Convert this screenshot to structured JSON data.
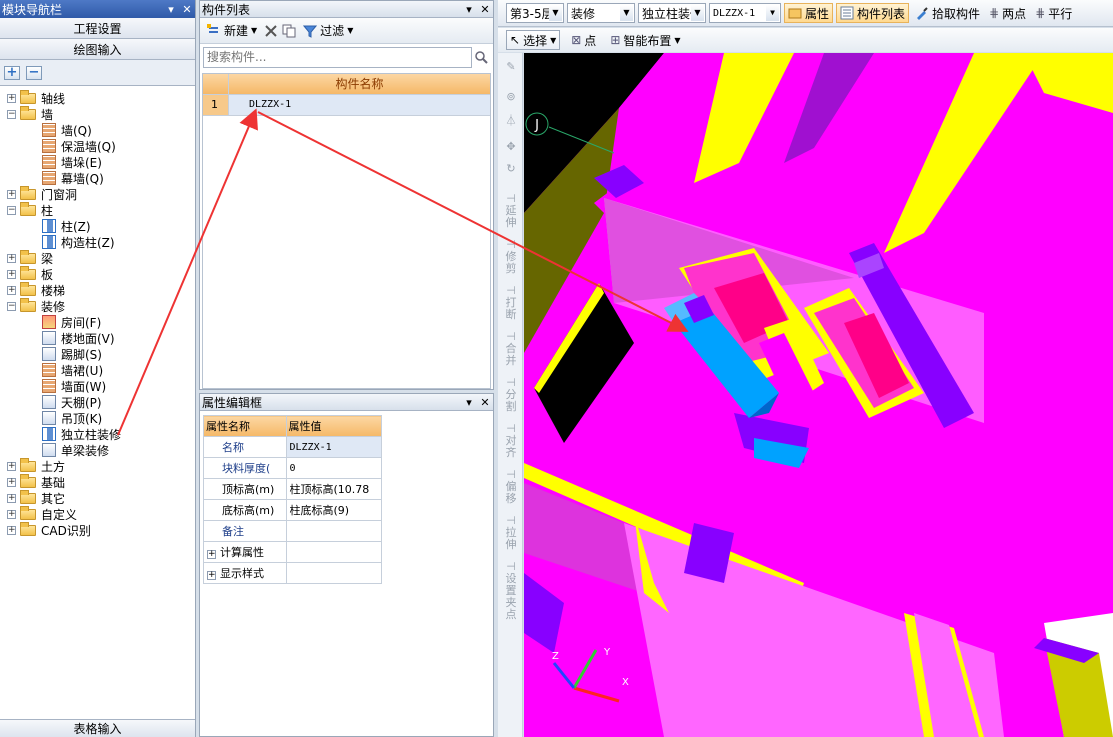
{
  "nav": {
    "title": "模块导航栏",
    "pin": "ᵖ",
    "close": "✕",
    "section1": "工程设置",
    "section2": "绘图输入",
    "bottom": "表格输入",
    "items": [
      {
        "label": "轴线",
        "level": 0,
        "exp": "+"
      },
      {
        "label": "墙",
        "level": 0,
        "exp": "−"
      },
      {
        "label": "墙(Q)",
        "level": 1
      },
      {
        "label": "保温墙(Q)",
        "level": 1
      },
      {
        "label": "墙垛(E)",
        "level": 1
      },
      {
        "label": "幕墙(Q)",
        "level": 1
      },
      {
        "label": "门窗洞",
        "level": 0,
        "exp": "+"
      },
      {
        "label": "柱",
        "level": 0,
        "exp": "−"
      },
      {
        "label": "柱(Z)",
        "level": 1
      },
      {
        "label": "构造柱(Z)",
        "level": 1
      },
      {
        "label": "梁",
        "level": 0,
        "exp": "+"
      },
      {
        "label": "板",
        "level": 0,
        "exp": "+"
      },
      {
        "label": "楼梯",
        "level": 0,
        "exp": "+"
      },
      {
        "label": "装修",
        "level": 0,
        "exp": "−"
      },
      {
        "label": "房间(F)",
        "level": 1
      },
      {
        "label": "楼地面(V)",
        "level": 1
      },
      {
        "label": "踢脚(S)",
        "level": 1
      },
      {
        "label": "墙裙(U)",
        "level": 1
      },
      {
        "label": "墙面(W)",
        "level": 1
      },
      {
        "label": "天棚(P)",
        "level": 1
      },
      {
        "label": "吊顶(K)",
        "level": 1
      },
      {
        "label": "独立柱装修",
        "level": 1
      },
      {
        "label": "单梁装修",
        "level": 1
      },
      {
        "label": "土方",
        "level": 0,
        "exp": "+"
      },
      {
        "label": "基础",
        "level": 0,
        "exp": "+"
      },
      {
        "label": "其它",
        "level": 0,
        "exp": "+"
      },
      {
        "label": "自定义",
        "level": 0,
        "exp": "+"
      },
      {
        "label": "CAD识别",
        "level": 0,
        "exp": "+"
      }
    ]
  },
  "clist": {
    "title": "构件列表",
    "new_label": "新建",
    "filter_label": "过滤",
    "search_placeholder": "搜索构件...",
    "col_header": "构件名称",
    "rows": [
      {
        "n": "1",
        "name": "DLZZX-1"
      }
    ]
  },
  "props": {
    "title": "属性编辑框",
    "col_name": "属性名称",
    "col_value": "属性值",
    "rows": [
      {
        "k": "名称",
        "v": "DLZZX-1"
      },
      {
        "k": "块料厚度(",
        "v": "0"
      },
      {
        "k": "顶标高(m)",
        "v": "柱顶标高(10.78"
      },
      {
        "k": "底标高(m)",
        "v": "柱底标高(9)"
      },
      {
        "k": "备注",
        "v": ""
      }
    ],
    "groups": [
      "计算属性",
      "显示样式"
    ]
  },
  "toolbar": {
    "floor": "第3-5层",
    "category": "装修",
    "type": "独立柱装修",
    "component": "DLZZX-1",
    "attr_label": "属性",
    "list_label": "构件列表",
    "pick_label": "拾取构件",
    "twopoint_label": "两点",
    "parallel_label": "平行"
  },
  "toolbar2": {
    "select_label": "选择",
    "point_label": "点",
    "smart_label": "智能布置"
  },
  "vstrip": {
    "tools": [
      "延伸",
      "修剪",
      "打断",
      "合并",
      "分割",
      "对齐",
      "偏移",
      "拉伸",
      "设置夹点"
    ]
  },
  "canvas": {
    "axis_label": "J",
    "axes": {
      "x": "X",
      "y": "Y",
      "z": "Z"
    }
  },
  "colors": {
    "magenta": "#ff00ff",
    "purple": "#8800ff",
    "yellow": "#ffff00",
    "column_blue": "#00a2ff",
    "arrow_red": "#ee3333"
  }
}
